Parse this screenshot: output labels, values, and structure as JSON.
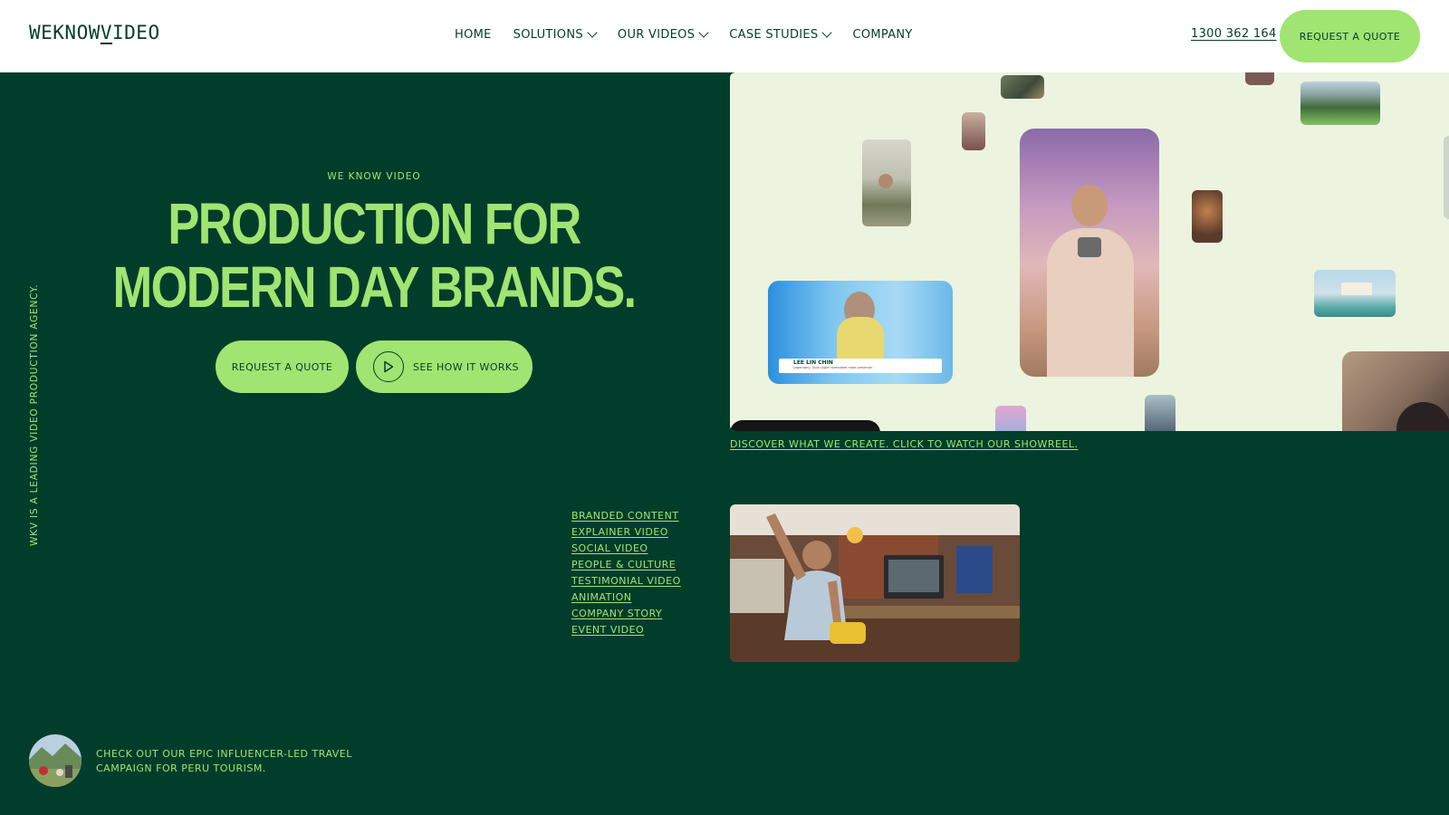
{
  "header": {
    "logo": {
      "part1": "WEKNOW",
      "part2": "V",
      "part3": "IDEO"
    },
    "nav": [
      {
        "label": "HOME",
        "dropdown": false
      },
      {
        "label": "SOLUTIONS",
        "dropdown": true
      },
      {
        "label": "OUR VIDEOS",
        "dropdown": true
      },
      {
        "label": "CASE STUDIES",
        "dropdown": true
      },
      {
        "label": "COMPANY",
        "dropdown": false
      }
    ],
    "phone": "1300 362 164",
    "cta": "REQUEST A QUOTE"
  },
  "side_text": "WKV IS A LEADING VIDEO PRODUCTION AGENCY.",
  "hero": {
    "eyebrow": "WE KNOW VIDEO",
    "title_line1": "PRODUCTION FOR",
    "title_line2": "MODERN DAY BRANDS.",
    "btn_quote": "REQUEST A QUOTE",
    "btn_how": "SEE HOW IT WORKS"
  },
  "showreel": {
    "link": "DISCOVER WHAT WE CREATE. CLICK TO WATCH OUR SHOWREEL.",
    "lower_third_name": "LEE LIN CHIN",
    "lower_third_sub": "Legendary, Gold Logie nominated news presenter"
  },
  "categories": [
    "BRANDED CONTENT",
    "EXPLAINER VIDEO",
    "SOCIAL VIDEO",
    "PEOPLE & CULTURE",
    "TESTIMONIAL VIDEO",
    "ANIMATION",
    "COMPANY STORY",
    "EVENT VIDEO"
  ],
  "promo": {
    "text": "CHECK OUT OUR EPIC INFLUENCER-LED TRAVEL CAMPAIGN FOR PERU TOURISM."
  },
  "colors": {
    "background": "#023d2b",
    "accent": "#a0e472",
    "header_bg": "#ffffff",
    "showreel_bg": "#ecf3df"
  },
  "icons": {
    "nav_dropdown": "chevron-down-icon",
    "see_how": "play-circle-icon"
  }
}
